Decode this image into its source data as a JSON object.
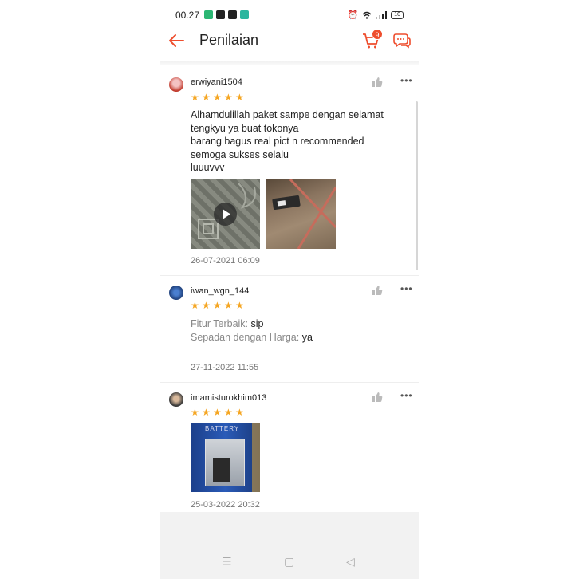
{
  "status_bar": {
    "time": "00.27",
    "battery": "10"
  },
  "header": {
    "title": "Penilaian",
    "cart_count": "9"
  },
  "reviews": [
    {
      "username": "erwiyani1504",
      "rating": 5,
      "lines": [
        "Alhamdulillah paket sampe dengan selamat",
        "tengkyu ya buat tokonya",
        "barang bagus real pict n recommended",
        "semoga sukses selalu",
        "luuuvvv"
      ],
      "date": "26-07-2021 06:09"
    },
    {
      "username": "iwan_wgn_144",
      "rating": 5,
      "features": [
        {
          "label": "Fitur Terbaik:",
          "value": "sip"
        },
        {
          "label": "Sepadan dengan Harga:",
          "value": "ya"
        }
      ],
      "date": "27-11-2022 11:55"
    },
    {
      "username": "imamisturokhim013",
      "rating": 5,
      "media_label": "BATTERY",
      "date": "25-03-2022 20:32"
    }
  ],
  "colors": {
    "accent": "#ee4d2d",
    "star": "#f5a623"
  }
}
